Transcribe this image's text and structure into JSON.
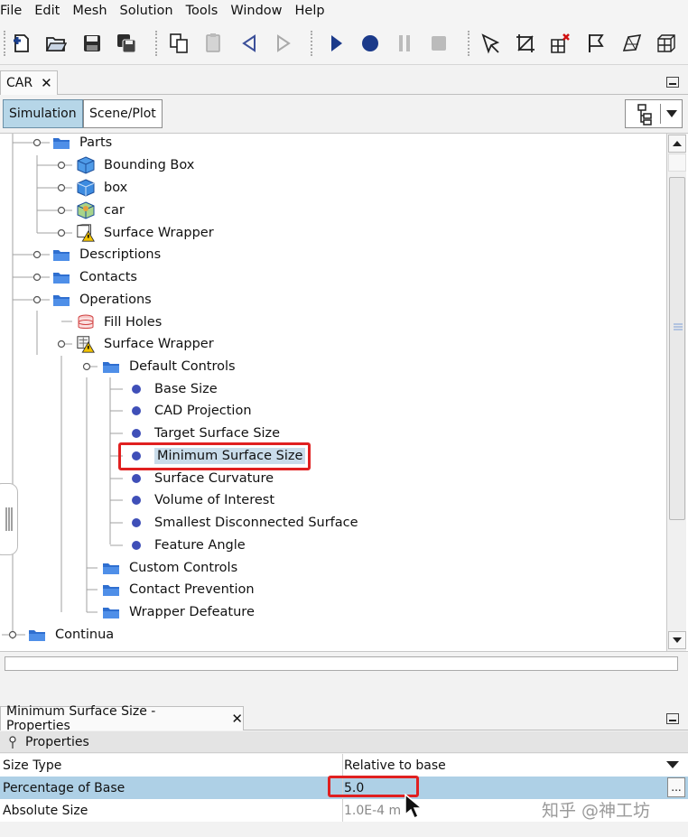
{
  "menu": [
    "File",
    "Edit",
    "Mesh",
    "Solution",
    "Tools",
    "Window",
    "Help"
  ],
  "toolbar_icons": [
    "new-icon",
    "open-icon",
    "save-icon",
    "save-as-icon",
    "copy-icon",
    "paste-icon",
    "step-back-icon",
    "step-forward-icon",
    "run-icon",
    "record-icon",
    "pause-icon",
    "stop-icon",
    "select-icon",
    "crop-icon",
    "grid-delete-icon",
    "flag-icon",
    "surface-icon",
    "volume-icon"
  ],
  "doc_tab": {
    "label": "CAR",
    "close": "✕"
  },
  "subtabs": {
    "simulation": "Simulation",
    "scene_plot": "Scene/Plot"
  },
  "tree": [
    {
      "label": "Parts",
      "icon": "folder"
    },
    {
      "label": "Bounding Box",
      "icon": "part-blue-box"
    },
    {
      "label": "box",
      "icon": "part-cube"
    },
    {
      "label": "car",
      "icon": "part-green"
    },
    {
      "label": "Surface Wrapper",
      "icon": "part-warning"
    },
    {
      "label": "Descriptions",
      "icon": "folder"
    },
    {
      "label": "Contacts",
      "icon": "folder"
    },
    {
      "label": "Operations",
      "icon": "folder"
    },
    {
      "label": "Fill Holes",
      "icon": "fill-holes"
    },
    {
      "label": "Surface Wrapper",
      "icon": "operation-warning"
    },
    {
      "label": "Default Controls",
      "icon": "folder"
    },
    {
      "label": "Base Size",
      "icon": "dot"
    },
    {
      "label": "CAD Projection",
      "icon": "dot"
    },
    {
      "label": "Target Surface Size",
      "icon": "dot"
    },
    {
      "label": "Minimum Surface Size",
      "icon": "dot"
    },
    {
      "label": "Surface Curvature",
      "icon": "dot"
    },
    {
      "label": "Volume of Interest",
      "icon": "dot"
    },
    {
      "label": "Smallest Disconnected Surface",
      "icon": "dot"
    },
    {
      "label": "Feature Angle",
      "icon": "dot"
    },
    {
      "label": "Custom Controls",
      "icon": "folder"
    },
    {
      "label": "Contact Prevention",
      "icon": "folder"
    },
    {
      "label": "Wrapper Defeature",
      "icon": "folder"
    },
    {
      "label": "Continua",
      "icon": "folder"
    }
  ],
  "properties": {
    "tab_label": "Minimum Surface Size - Properties",
    "close": "✕",
    "header": "Properties",
    "rows": [
      {
        "name": "Size Type",
        "value": "Relative to base"
      },
      {
        "name": "Percentage of Base",
        "value": "5.0"
      },
      {
        "name": "Absolute Size",
        "value": "1.0E-4 m"
      }
    ],
    "ellipsis": "..."
  },
  "watermark": "知乎 @神工坊",
  "colors": {
    "selection": "#aed0e6",
    "highlight_box": "#e02020",
    "folder": "#2f6fd0",
    "dot": "#3f4fb8"
  }
}
